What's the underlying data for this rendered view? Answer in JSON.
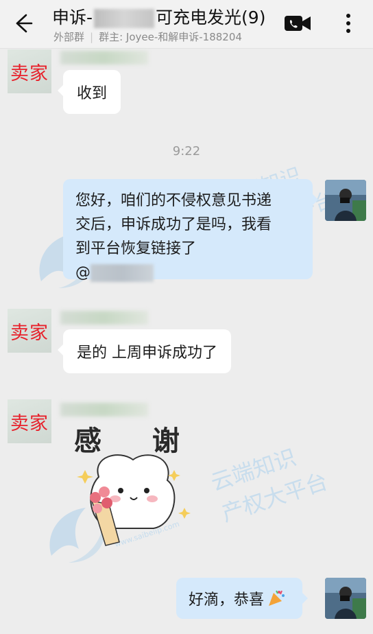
{
  "header": {
    "title_prefix": "申诉-",
    "title_suffix": "可充电发光",
    "member_count": "(9)",
    "subtitle_group_type": "外部群",
    "subtitle_owner": "群主: Joyee-和解申诉-188204"
  },
  "messages": [
    {
      "sender_label": "卖家",
      "text": "收到"
    },
    {
      "timestamp": "9:22"
    },
    {
      "from_me": true,
      "text": "您好，咱们的不侵权意见书递交后，申诉成功了是吗，我看到平台恢复链接了",
      "mention": "@"
    },
    {
      "sender_label": "卖家",
      "text": "是的 上周申诉成功了"
    },
    {
      "sender_label": "卖家",
      "sticker_text": "感 谢"
    },
    {
      "from_me": true,
      "text": "好滴，恭喜"
    }
  ],
  "watermark": {
    "line1": "云端知识",
    "line2": "产权大平台",
    "url": "www.saibeiip.com"
  },
  "colors": {
    "incoming_bubble": "#ffffff",
    "outgoing_bubble": "#d5e9fb",
    "seller_label": "#e8202a",
    "background": "#ededed"
  }
}
